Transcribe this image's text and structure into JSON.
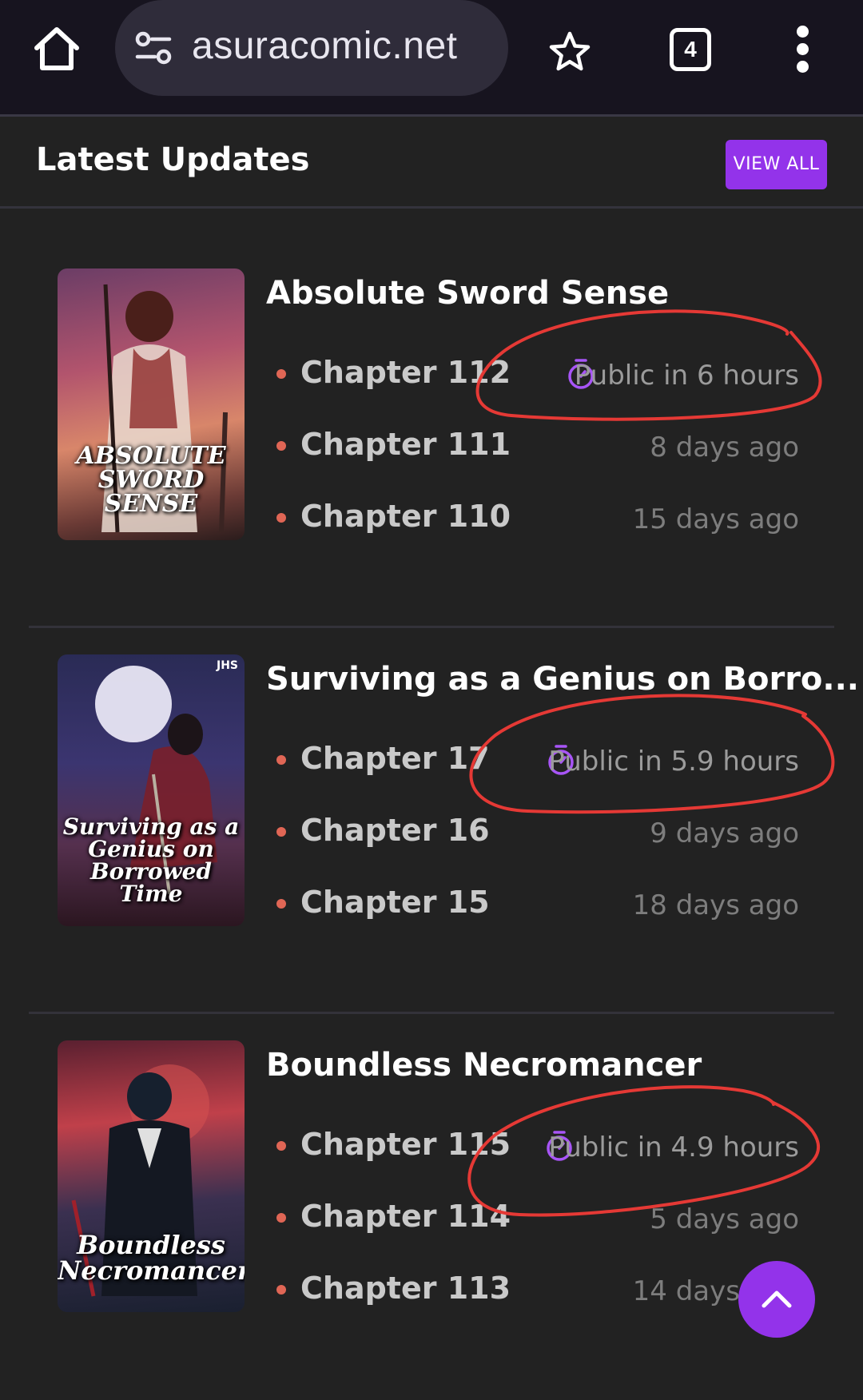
{
  "browser": {
    "url": "asuracomic.net",
    "tab_count": "4",
    "icons": [
      "home-icon",
      "site-settings-icon",
      "star-icon",
      "tabs-icon",
      "more-vert-icon"
    ]
  },
  "section": {
    "title": "Latest Updates",
    "view_all_label": "VIEW ALL"
  },
  "series": [
    {
      "title": "Absolute Sword Sense",
      "cover_title": "ABSOLUTE SWORD SENSE",
      "chapters": [
        {
          "label": "Chapter 112",
          "time": "Public in 6 hours"
        },
        {
          "label": "Chapter 111",
          "time": "8 days ago"
        },
        {
          "label": "Chapter 110",
          "time": "15 days ago"
        }
      ]
    },
    {
      "title": "Surviving as a Genius on Borro...",
      "cover_title": "Surviving as a Genius on Borrowed Time",
      "cover_badge": "JHS",
      "chapters": [
        {
          "label": "Chapter 17",
          "time": "Public in 5.9 hours"
        },
        {
          "label": "Chapter 16",
          "time": "9 days ago"
        },
        {
          "label": "Chapter 15",
          "time": "18 days ago"
        }
      ]
    },
    {
      "title": "Boundless Necromancer",
      "cover_title": "Boundless Necromancer",
      "chapters": [
        {
          "label": "Chapter 115",
          "time": "Public in 4.9 hours"
        },
        {
          "label": "Chapter 114",
          "time": "5 days ago"
        },
        {
          "label": "Chapter 113",
          "time": "14 days ago"
        }
      ]
    }
  ],
  "colors": {
    "accent": "#9333ea",
    "annotation": "#e53935",
    "bullet": "#e06655",
    "background": "#222222"
  }
}
